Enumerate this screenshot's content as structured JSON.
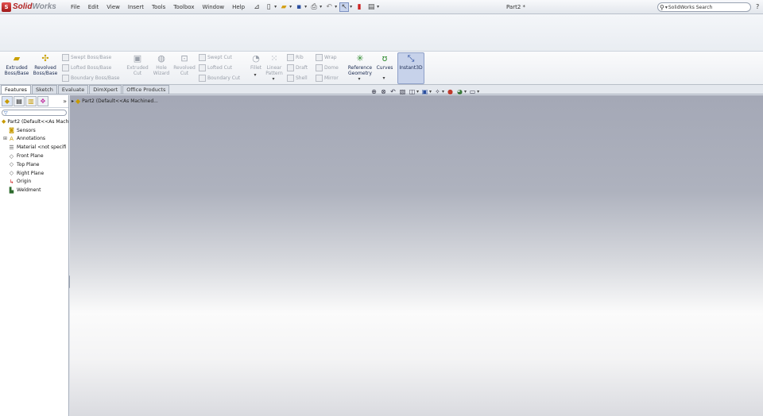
{
  "app": {
    "logo_text": "SolidWorks",
    "logo_prefix": "Solid",
    "logo_suffix": "Works",
    "doc_title": "Part2 *"
  },
  "menu": [
    "File",
    "Edit",
    "View",
    "Insert",
    "Tools",
    "Toolbox",
    "Window",
    "Help"
  ],
  "search": {
    "value": "SolidWorks Search",
    "help": "?"
  },
  "commands": {
    "extruded_boss": "Extruded Boss/Base",
    "revolved_boss": "Revolved Boss/Base",
    "swept_boss": "Swept Boss/Base",
    "lofted_boss": "Lofted Boss/Base",
    "boundary_boss": "Boundary Boss/Base",
    "extruded_cut": "Extruded Cut",
    "hole_wizard": "Hole Wizard",
    "revolved_cut": "Revolved Cut",
    "swept_cut": "Swept Cut",
    "lofted_cut": "Lofted Cut",
    "boundary_cut": "Boundary Cut",
    "fillet": "Fillet",
    "linear_pattern": "Linear Pattern",
    "rib": "Rib",
    "draft": "Draft",
    "shell": "Shell",
    "wrap": "Wrap",
    "dome": "Dome",
    "mirror": "Mirror",
    "reference_geometry": "Reference Geometry",
    "curves": "Curves",
    "instant3d": "Instant3D"
  },
  "tabs": [
    "Features",
    "Sketch",
    "Evaluate",
    "DimXpert",
    "Office Products"
  ],
  "tree": [
    {
      "label": "Part2  (Default<<As Mach",
      "icon": "part-icon"
    },
    {
      "label": "Sensors",
      "icon": "sensors-icon"
    },
    {
      "label": "Annotations",
      "icon": "annotations-icon"
    },
    {
      "label": "Material <not specifi",
      "icon": "material-icon"
    },
    {
      "label": "Front Plane",
      "icon": "plane-icon"
    },
    {
      "label": "Top Plane",
      "icon": "plane-icon"
    },
    {
      "label": "Right Plane",
      "icon": "plane-icon"
    },
    {
      "label": "Origin",
      "icon": "origin-icon"
    },
    {
      "label": "Weldment",
      "icon": "weldment-icon"
    }
  ],
  "flyout": {
    "label": "Part2  (Default<<As Machined..."
  },
  "colors": {
    "accent": "#b12020",
    "active_tool": "#c7d2ea",
    "viewport_top": "#a4a8b6"
  }
}
